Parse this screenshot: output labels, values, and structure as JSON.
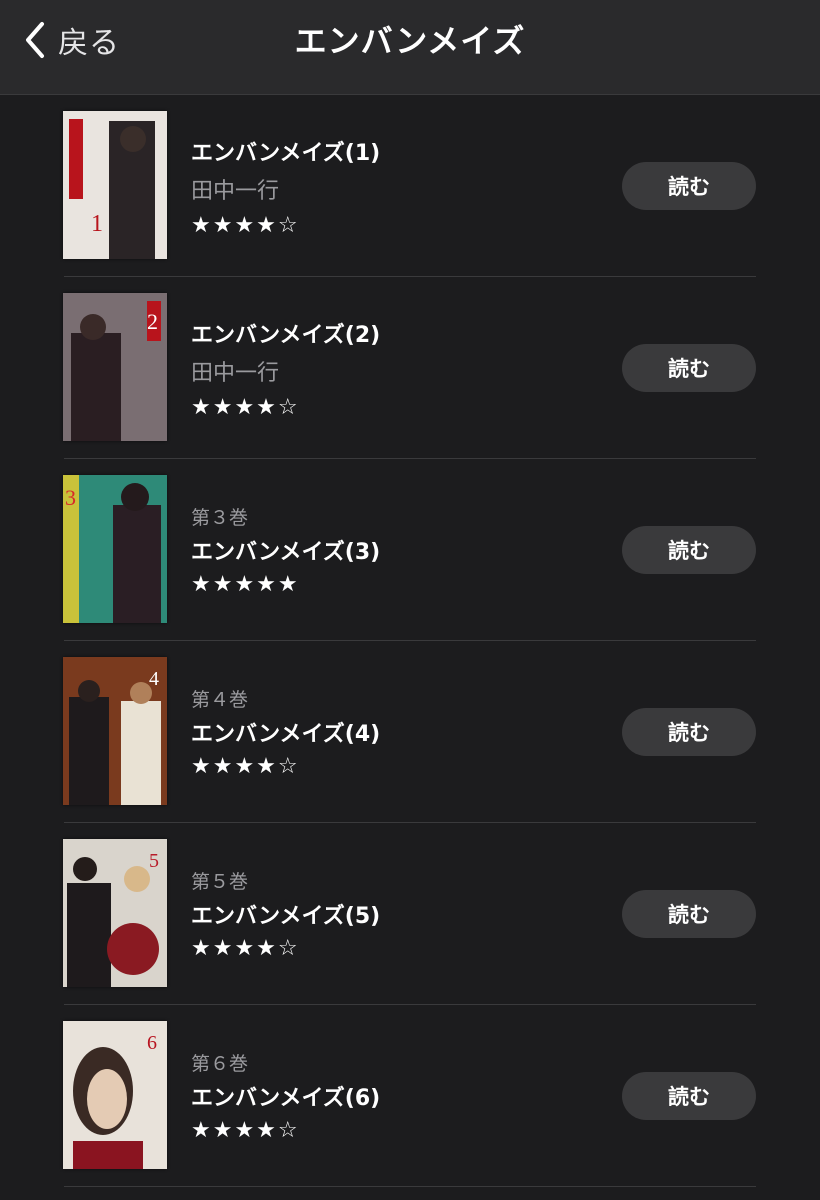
{
  "nav": {
    "back_label": "戻る",
    "title": "エンバンメイズ"
  },
  "books": [
    {
      "volume": "",
      "title": "エンバンメイズ(1)",
      "author": "田中一行",
      "stars": "★★★★☆",
      "read_label": "読む",
      "cover_color": "#e9e4df",
      "accent": "#b8141c",
      "cover_number": "1"
    },
    {
      "volume": "",
      "title": "エンバンメイズ(2)",
      "author": "田中一行",
      "stars": "★★★★☆",
      "read_label": "読む",
      "cover_color": "#7a6e72",
      "accent": "#b8141c",
      "cover_number": "2"
    },
    {
      "volume": "第３巻",
      "title": "エンバンメイズ(3)",
      "author": "",
      "stars": "★★★★★",
      "read_label": "読む",
      "cover_color": "#2e8a78",
      "accent": "#d62a2a",
      "cover_number": "3"
    },
    {
      "volume": "第４巻",
      "title": "エンバンメイズ(4)",
      "author": "",
      "stars": "★★★★☆",
      "read_label": "読む",
      "cover_color": "#7a3a1e",
      "accent": "#e04a2a",
      "cover_number": "4"
    },
    {
      "volume": "第５巻",
      "title": "エンバンメイズ(5)",
      "author": "",
      "stars": "★★★★☆",
      "read_label": "読む",
      "cover_color": "#d9d4cc",
      "accent": "#b81c2a",
      "cover_number": "5"
    },
    {
      "volume": "第６巻",
      "title": "エンバンメイズ(6)",
      "author": "",
      "stars": "★★★★☆",
      "read_label": "読む",
      "cover_color": "#e8e2da",
      "accent": "#b81420",
      "cover_number": "6"
    }
  ]
}
